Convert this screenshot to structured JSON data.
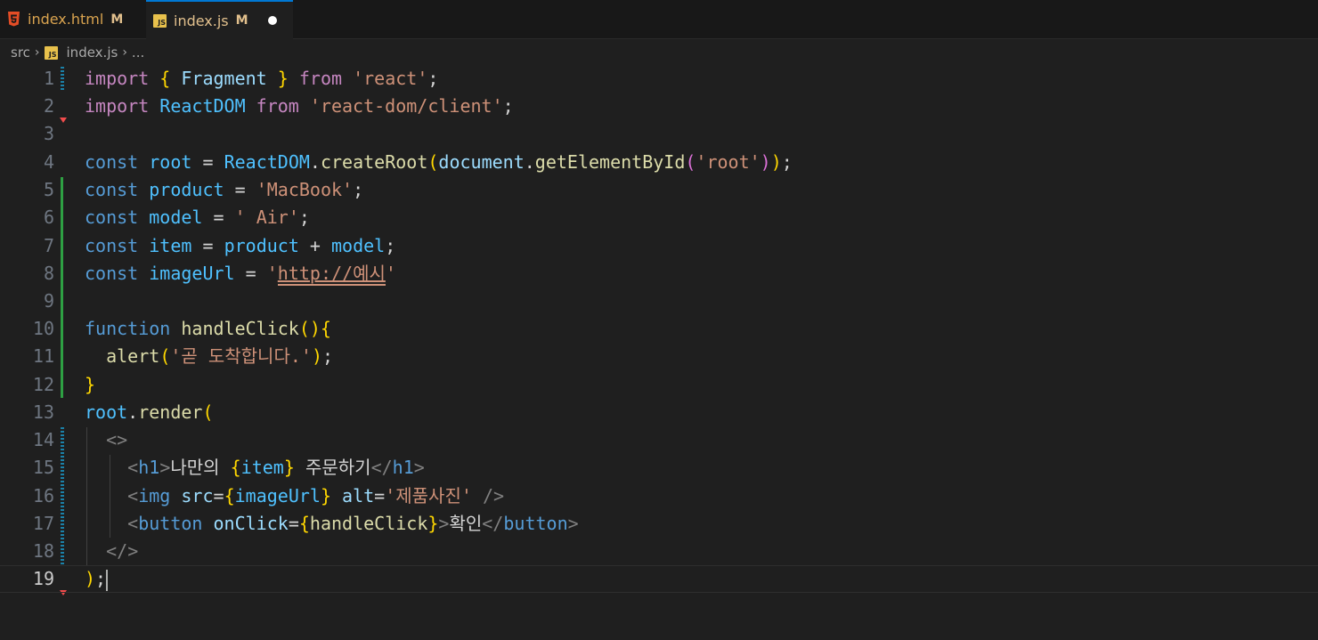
{
  "tabs": [
    {
      "label": "index.html",
      "modified": "M",
      "icon": "html5-icon"
    },
    {
      "label": "index.js",
      "modified": "M",
      "icon": "javascript-icon",
      "unsaved": true
    }
  ],
  "breadcrumb": {
    "folder": "src",
    "file": "index.js",
    "more": "..."
  },
  "editor": {
    "current_line": 19,
    "lines": [
      "import { Fragment } from 'react';",
      "import ReactDOM from 'react-dom/client';",
      "",
      "const root = ReactDOM.createRoot(document.getElementById('root'));",
      "const product = 'MacBook';",
      "const model = ' Air';",
      "const item = product + model;",
      "const imageUrl = 'http://예시'",
      "",
      "function handleClick(){",
      "  alert('곧 도착합니다.');",
      "}",
      "root.render(",
      "  <>",
      "    <h1>나만의 {item} 주문하기</h1>",
      "    <img src={imageUrl} alt='제품사진' />",
      "    <button onClick={handleClick}>확인</button>",
      "  </>",
      ");"
    ]
  },
  "colors": {
    "accent": "#0078d4",
    "background": "#1f1f1f",
    "modified": "#e2c08d"
  }
}
